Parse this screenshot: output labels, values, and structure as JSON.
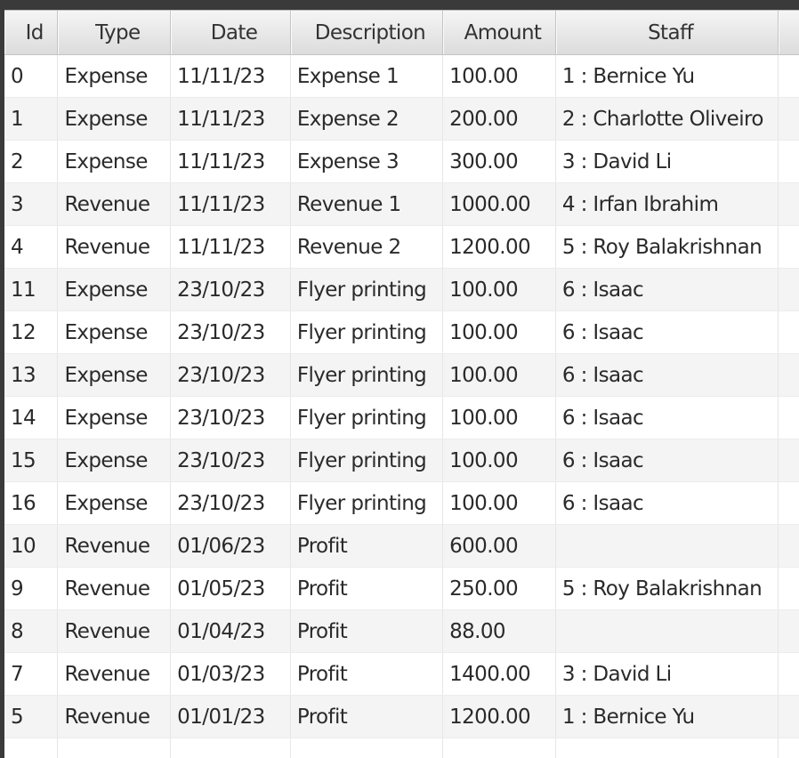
{
  "columns": [
    "Id",
    "Type",
    "Date",
    "Description",
    "Amount",
    "Staff"
  ],
  "rows": [
    [
      "0",
      "Expense",
      "11/11/23",
      "Expense 1",
      "100.00",
      "1 : Bernice Yu"
    ],
    [
      "1",
      "Expense",
      "11/11/23",
      "Expense 2",
      "200.00",
      "2 : Charlotte Oliveiro"
    ],
    [
      "2",
      "Expense",
      "11/11/23",
      "Expense 3",
      "300.00",
      "3 : David Li"
    ],
    [
      "3",
      "Revenue",
      "11/11/23",
      "Revenue 1",
      "1000.00",
      "4 : Irfan Ibrahim"
    ],
    [
      "4",
      "Revenue",
      "11/11/23",
      "Revenue 2",
      "1200.00",
      "5 : Roy Balakrishnan"
    ],
    [
      "11",
      "Expense",
      "23/10/23",
      "Flyer printing",
      "100.00",
      "6 : Isaac"
    ],
    [
      "12",
      "Expense",
      "23/10/23",
      "Flyer printing",
      "100.00",
      "6 : Isaac"
    ],
    [
      "13",
      "Expense",
      "23/10/23",
      "Flyer printing",
      "100.00",
      "6 : Isaac"
    ],
    [
      "14",
      "Expense",
      "23/10/23",
      "Flyer printing",
      "100.00",
      "6 : Isaac"
    ],
    [
      "15",
      "Expense",
      "23/10/23",
      "Flyer printing",
      "100.00",
      "6 : Isaac"
    ],
    [
      "16",
      "Expense",
      "23/10/23",
      "Flyer printing",
      "100.00",
      "6 : Isaac"
    ],
    [
      "10",
      "Revenue",
      "01/06/23",
      "Profit",
      "600.00",
      ""
    ],
    [
      "9",
      "Revenue",
      "01/05/23",
      "Profit",
      "250.00",
      "5 : Roy Balakrishnan"
    ],
    [
      "8",
      "Revenue",
      "01/04/23",
      "Profit",
      "88.00",
      ""
    ],
    [
      "7",
      "Revenue",
      "01/03/23",
      "Profit",
      "1400.00",
      "3 : David Li"
    ],
    [
      "5",
      "Revenue",
      "01/01/23",
      "Profit",
      "1200.00",
      "1 : Bernice Yu"
    ],
    [
      "",
      "",
      "",
      "",
      "",
      ""
    ]
  ]
}
